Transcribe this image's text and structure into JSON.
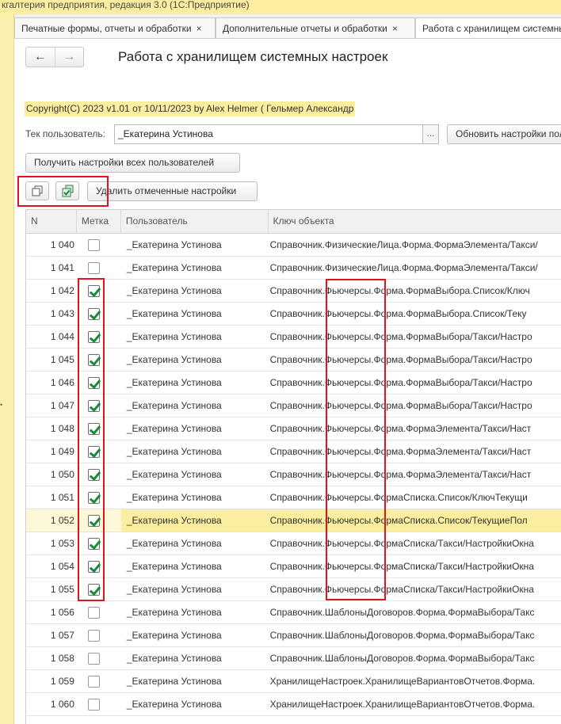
{
  "window": {
    "title": "кгалтерия предприятия, редакция 3.0  (1С:Предприятие)"
  },
  "tabs": [
    {
      "label": "Печатные формы, отчеты и обработки",
      "close": "×"
    },
    {
      "label": "Дополнительные отчеты и обработки",
      "close": "×"
    },
    {
      "label": "Работа с хранилищем системных настроек"
    }
  ],
  "nav": {
    "back": "←",
    "forward": "→"
  },
  "page": {
    "title": "Работа с хранилищем системных настроек",
    "copyright": "Copyright(C)  2023 v1.01 от 10/11/2023  by Alex Helmer ( Гельмер Александр"
  },
  "user": {
    "label": "Тек пользователь:",
    "value": "_Екатерина Устинова",
    "select_button": "..."
  },
  "buttons": {
    "refresh": "Обновить настройки пользователя",
    "get_all": "Получить настройки всех пользователей",
    "delete_marked": "Удалить отмеченные настройки",
    "check_all_icon": "copy-icon",
    "uncheck_all_icon": "check-all-icon"
  },
  "grid": {
    "columns": {
      "n": "N",
      "mark": "Метка",
      "user": "Пользователь",
      "key": "Ключ объекта"
    },
    "rows": [
      {
        "n": "1 040",
        "checked": false,
        "user": "_Екатерина Устинова",
        "key": "Справочник.ФизическиеЛица.Форма.ФормаЭлемента/Такси/"
      },
      {
        "n": "1 041",
        "checked": false,
        "user": "_Екатерина Устинова",
        "key": "Справочник.ФизическиеЛица.Форма.ФормаЭлемента/Такси/"
      },
      {
        "n": "1 042",
        "checked": true,
        "user": "_Екатерина Устинова",
        "key": "Справочник.Фьючерсы.Форма.ФормаВыбора.Список/Ключ"
      },
      {
        "n": "1 043",
        "checked": true,
        "user": "_Екатерина Устинова",
        "key": "Справочник.Фьючерсы.Форма.ФормаВыбора.Список/Теку"
      },
      {
        "n": "1 044",
        "checked": true,
        "user": "_Екатерина Устинова",
        "key": "Справочник.Фьючерсы.Форма.ФормаВыбора/Такси/Настро"
      },
      {
        "n": "1 045",
        "checked": true,
        "user": "_Екатерина Устинова",
        "key": "Справочник.Фьючерсы.Форма.ФормаВыбора/Такси/Настро"
      },
      {
        "n": "1 046",
        "checked": true,
        "user": "_Екатерина Устинова",
        "key": "Справочник.Фьючерсы.Форма.ФормаВыбора/Такси/Настро"
      },
      {
        "n": "1 047",
        "checked": true,
        "user": "_Екатерина Устинова",
        "key": "Справочник.Фьючерсы.Форма.ФормаВыбора/Такси/Настро"
      },
      {
        "n": "1 048",
        "checked": true,
        "user": "_Екатерина Устинова",
        "key": "Справочник.Фьючерсы.Форма.ФормаЭлемента/Такси/Наст"
      },
      {
        "n": "1 049",
        "checked": true,
        "user": "_Екатерина Устинова",
        "key": "Справочник.Фьючерсы.Форма.ФормаЭлемента/Такси/Наст"
      },
      {
        "n": "1 050",
        "checked": true,
        "user": "_Екатерина Устинова",
        "key": "Справочник.Фьючерсы.Форма.ФормаЭлемента/Такси/Наст"
      },
      {
        "n": "1 051",
        "checked": true,
        "user": "_Екатерина Устинова",
        "key": "Справочник.Фьючерсы.ФормаСписка.Список/КлючТекущи"
      },
      {
        "n": "1 052",
        "checked": true,
        "user": "_Екатерина Устинова",
        "key": "Справочник.Фьючерсы.ФормаСписка.Список/ТекущиеПол",
        "selected": true
      },
      {
        "n": "1 053",
        "checked": true,
        "user": "_Екатерина Устинова",
        "key": "Справочник.Фьючерсы.ФормаСписка/Такси/НастройкиОкна"
      },
      {
        "n": "1 054",
        "checked": true,
        "user": "_Екатерина Устинова",
        "key": "Справочник.Фьючерсы.ФормаСписка/Такси/НастройкиОкна"
      },
      {
        "n": "1 055",
        "checked": true,
        "user": "_Екатерина Устинова",
        "key": "Справочник.Фьючерсы.ФормаСписка/Такси/НастройкиОкна"
      },
      {
        "n": "1 056",
        "checked": false,
        "user": "_Екатерина Устинова",
        "key": "Справочник.ШаблоныДоговоров.Форма.ФормаВыбора/Такс"
      },
      {
        "n": "1 057",
        "checked": false,
        "user": "_Екатерина Устинова",
        "key": "Справочник.ШаблоныДоговоров.Форма.ФормаВыбора/Такс"
      },
      {
        "n": "1 058",
        "checked": false,
        "user": "_Екатерина Устинова",
        "key": "Справочник.ШаблоныДоговоров.Форма.ФормаВыбора/Такс"
      },
      {
        "n": "1 059",
        "checked": false,
        "user": "_Екатерина Устинова",
        "key": "ХранилищеНастроек.ХранилищеВариантовОтчетов.Форма."
      },
      {
        "n": "1 060",
        "checked": false,
        "user": "_Екатерина Устинова",
        "key": "ХранилищеНастроек.ХранилищеВариантовОтчетов.Форма."
      }
    ]
  },
  "colors": {
    "highlight": "#fbee9e",
    "annotation": "#e0141e",
    "check": "#1a8a3c"
  }
}
